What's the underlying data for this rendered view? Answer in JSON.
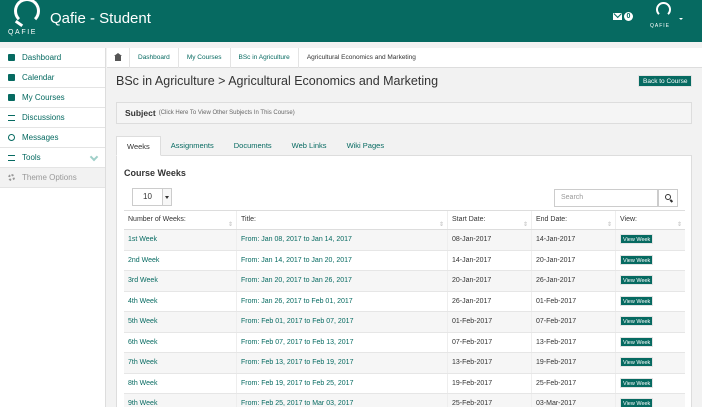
{
  "header": {
    "logo_text": "QAFIE",
    "title": "Qafie - Student",
    "mail_count": "0",
    "user_logo_text": "QAFIE"
  },
  "sidebar": {
    "items": [
      {
        "label": "Dashboard",
        "icon": "dashboard-icon"
      },
      {
        "label": "Calendar",
        "icon": "calendar-icon"
      },
      {
        "label": "My Courses",
        "icon": "courses-icon"
      },
      {
        "label": "Discussions",
        "icon": "discussions-icon"
      },
      {
        "label": "Messages",
        "icon": "messages-icon"
      },
      {
        "label": "Tools",
        "icon": "tools-icon"
      },
      {
        "label": "Theme Options",
        "icon": "gear-icon"
      }
    ]
  },
  "breadcrumb": {
    "items": [
      "Dashboard",
      "My Courses",
      "BSc in Agriculture",
      "Agricultural Economics and Marketing"
    ]
  },
  "page": {
    "title": "BSc in Agriculture > Agricultural Economics and Marketing",
    "back_label": "Back to Course",
    "subject_label": "Subject",
    "subject_hint": "(Click Here To View Other Subjects In This Course)"
  },
  "tabs": [
    "Weeks",
    "Assignments",
    "Documents",
    "Web Links",
    "Wiki Pages"
  ],
  "panel": {
    "title": "Course Weeks",
    "page_length": "10",
    "search_placeholder": "Search"
  },
  "table": {
    "headers": [
      "Number of Weeks:",
      "Title:",
      "Start Date:",
      "End Date:",
      "View:"
    ],
    "button_label": "View Week",
    "rows": [
      {
        "week": "1st Week",
        "title": "From: Jan 08, 2017 to Jan 14, 2017",
        "start": "08-Jan-2017",
        "end": "14-Jan-2017"
      },
      {
        "week": "2nd Week",
        "title": "From: Jan 14, 2017 to Jan 20, 2017",
        "start": "14-Jan-2017",
        "end": "20-Jan-2017"
      },
      {
        "week": "3rd Week",
        "title": "From: Jan 20, 2017 to Jan 26, 2017",
        "start": "20-Jan-2017",
        "end": "26-Jan-2017"
      },
      {
        "week": "4th Week",
        "title": "From: Jan 26, 2017 to Feb 01, 2017",
        "start": "26-Jan-2017",
        "end": "01-Feb-2017"
      },
      {
        "week": "5th Week",
        "title": "From: Feb 01, 2017 to Feb 07, 2017",
        "start": "01-Feb-2017",
        "end": "07-Feb-2017"
      },
      {
        "week": "6th Week",
        "title": "From: Feb 07, 2017 to Feb 13, 2017",
        "start": "07-Feb-2017",
        "end": "13-Feb-2017"
      },
      {
        "week": "7th Week",
        "title": "From: Feb 13, 2017 to Feb 19, 2017",
        "start": "13-Feb-2017",
        "end": "19-Feb-2017"
      },
      {
        "week": "8th Week",
        "title": "From: Feb 19, 2017 to Feb 25, 2017",
        "start": "19-Feb-2017",
        "end": "25-Feb-2017"
      },
      {
        "week": "9th Week",
        "title": "From: Feb 25, 2017 to Mar 03, 2017",
        "start": "25-Feb-2017",
        "end": "03-Mar-2017"
      }
    ]
  },
  "colors": {
    "brand": "#066a61"
  }
}
